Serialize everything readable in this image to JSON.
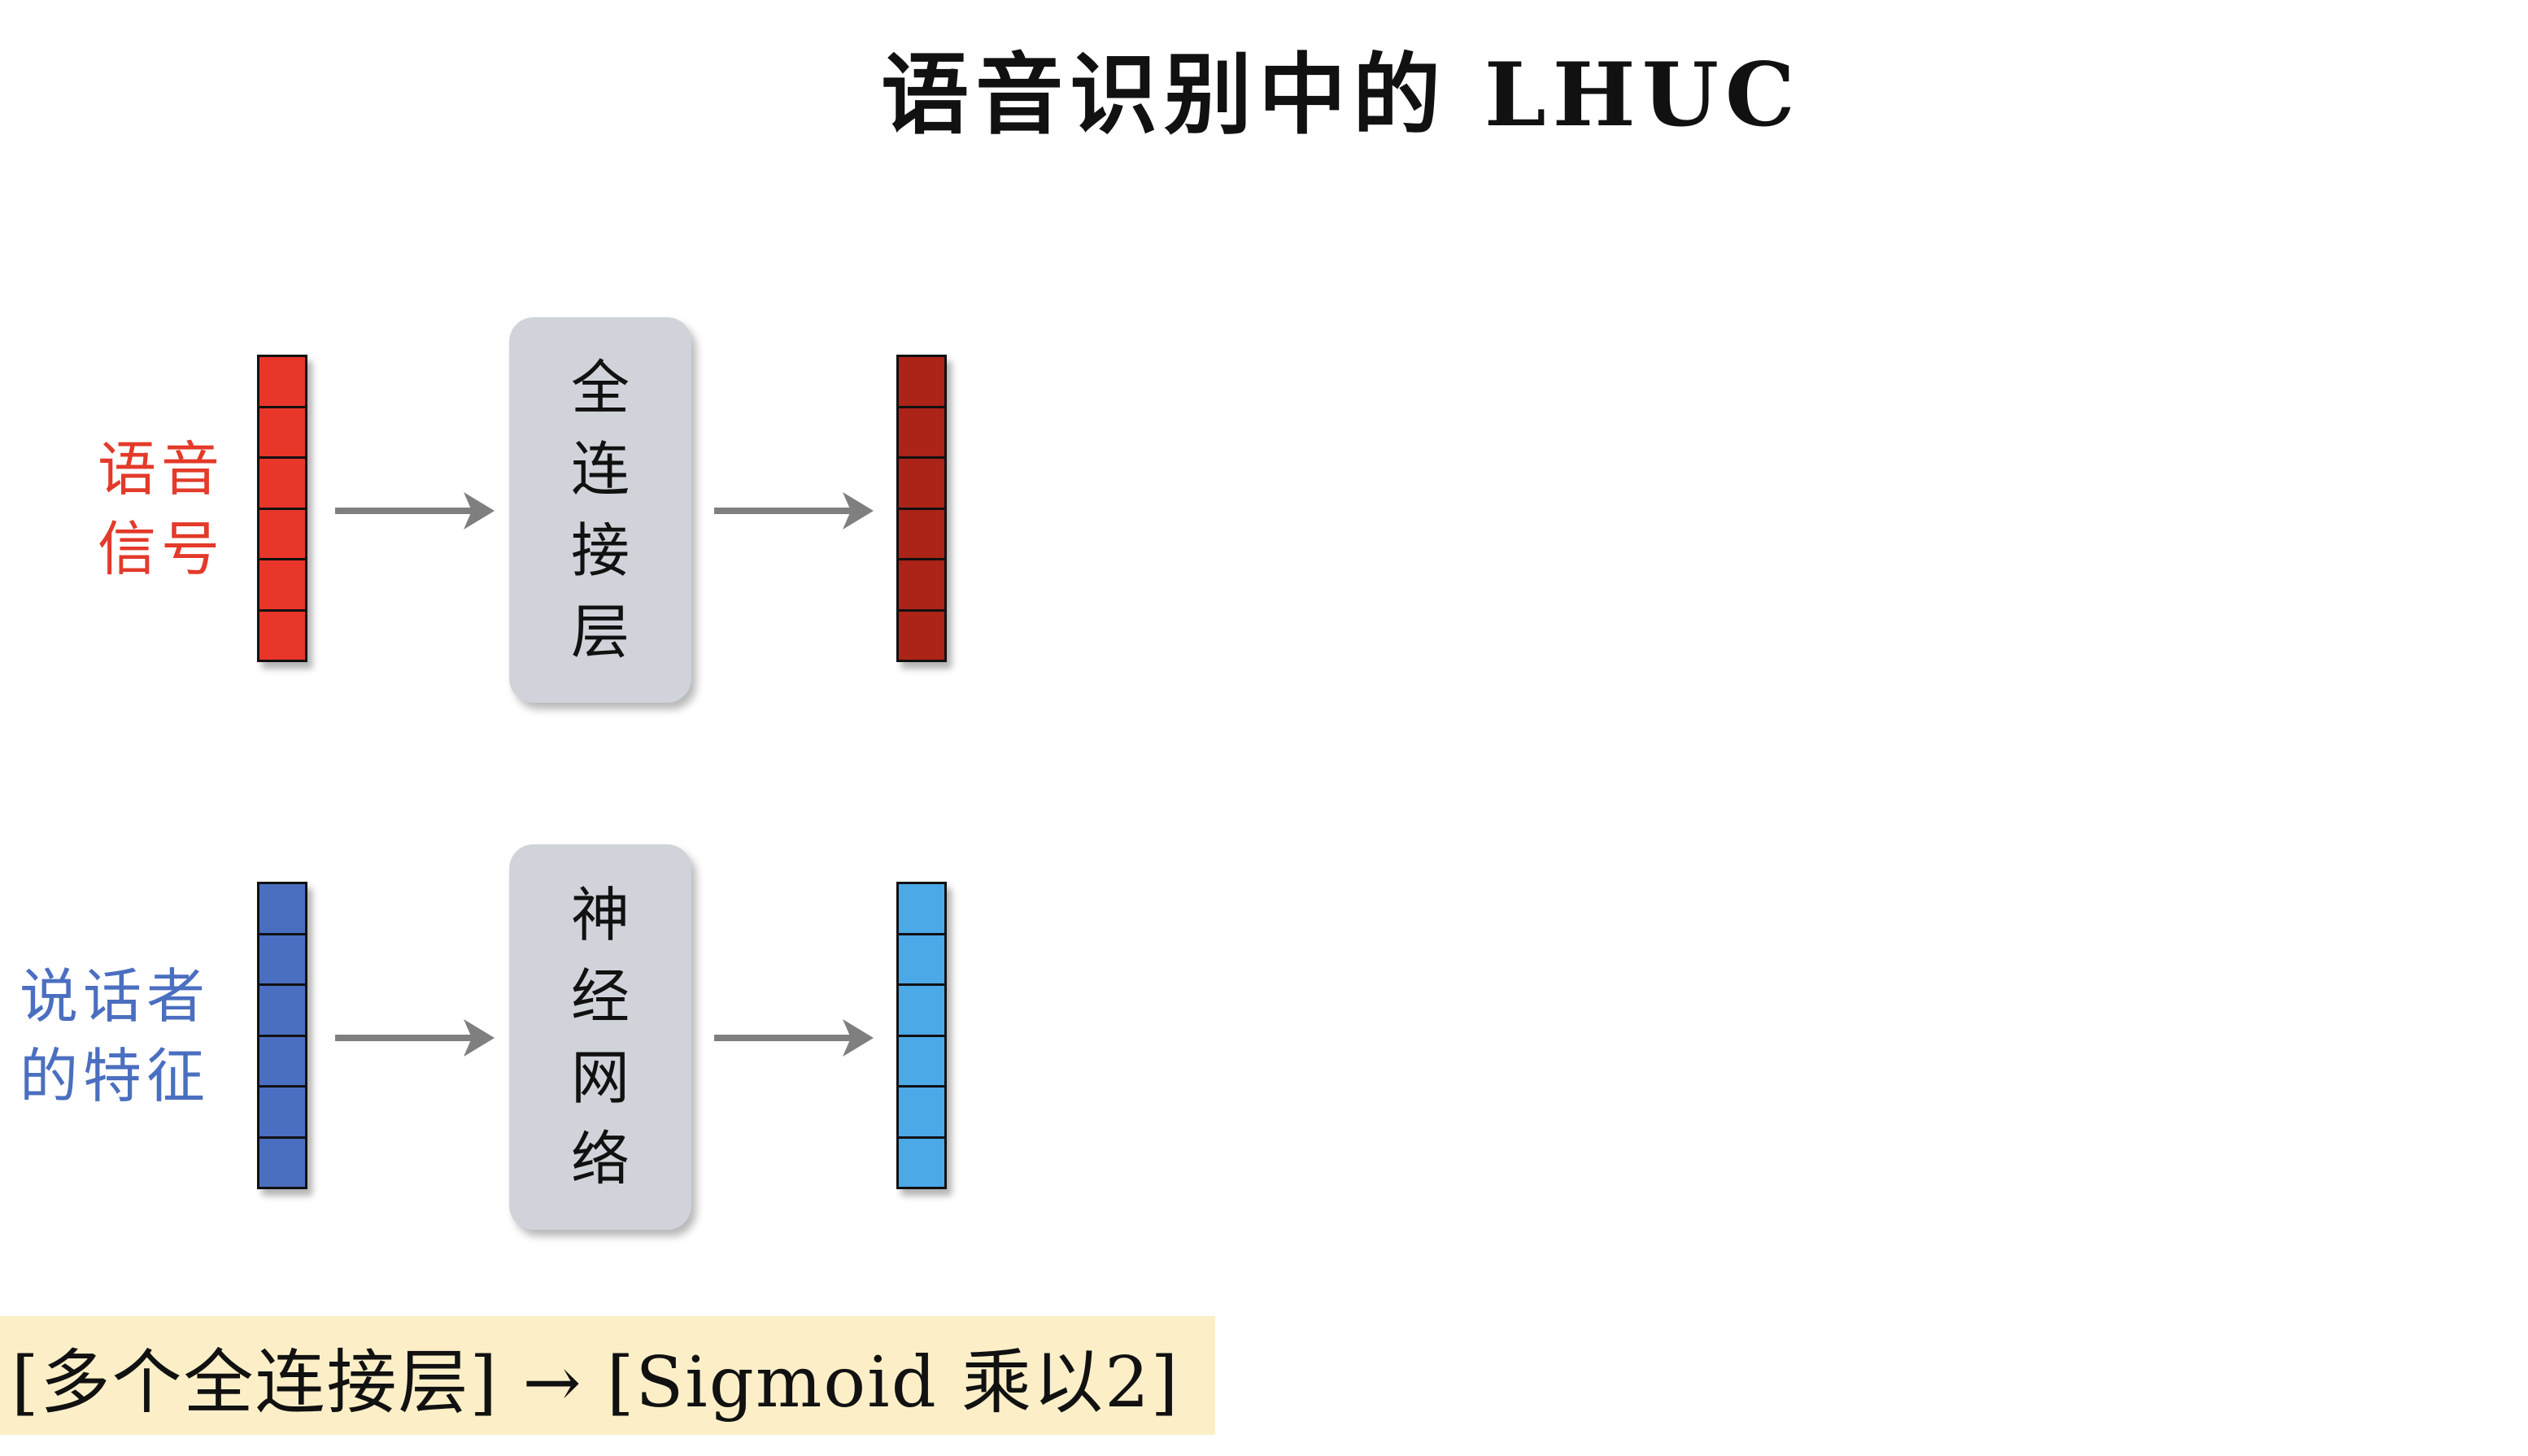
{
  "title": "语音识别中的 LHUC",
  "colors": {
    "speech_input": "#e8362a",
    "speech_output": "#ac2318",
    "speaker_input": "#4b6fc0",
    "speaker_output": "#4ba9e8",
    "speech_label": "#e33a2a",
    "speaker_label": "#4b6fc0",
    "box": "#d0d4da",
    "arrow": "#7f7f7f",
    "note_bg": "#fcefc8"
  },
  "rows": [
    {
      "label_lines": [
        "语音",
        "信号"
      ],
      "box_lines": [
        "全",
        "连",
        "接",
        "层"
      ],
      "cells": 6
    },
    {
      "label_lines": [
        "说话者",
        "的特征"
      ],
      "box_lines": [
        "神",
        "经",
        "网",
        "络"
      ],
      "cells": 6
    }
  ],
  "note": "[多个全连接层] → [Sigmoid 乘以2]"
}
